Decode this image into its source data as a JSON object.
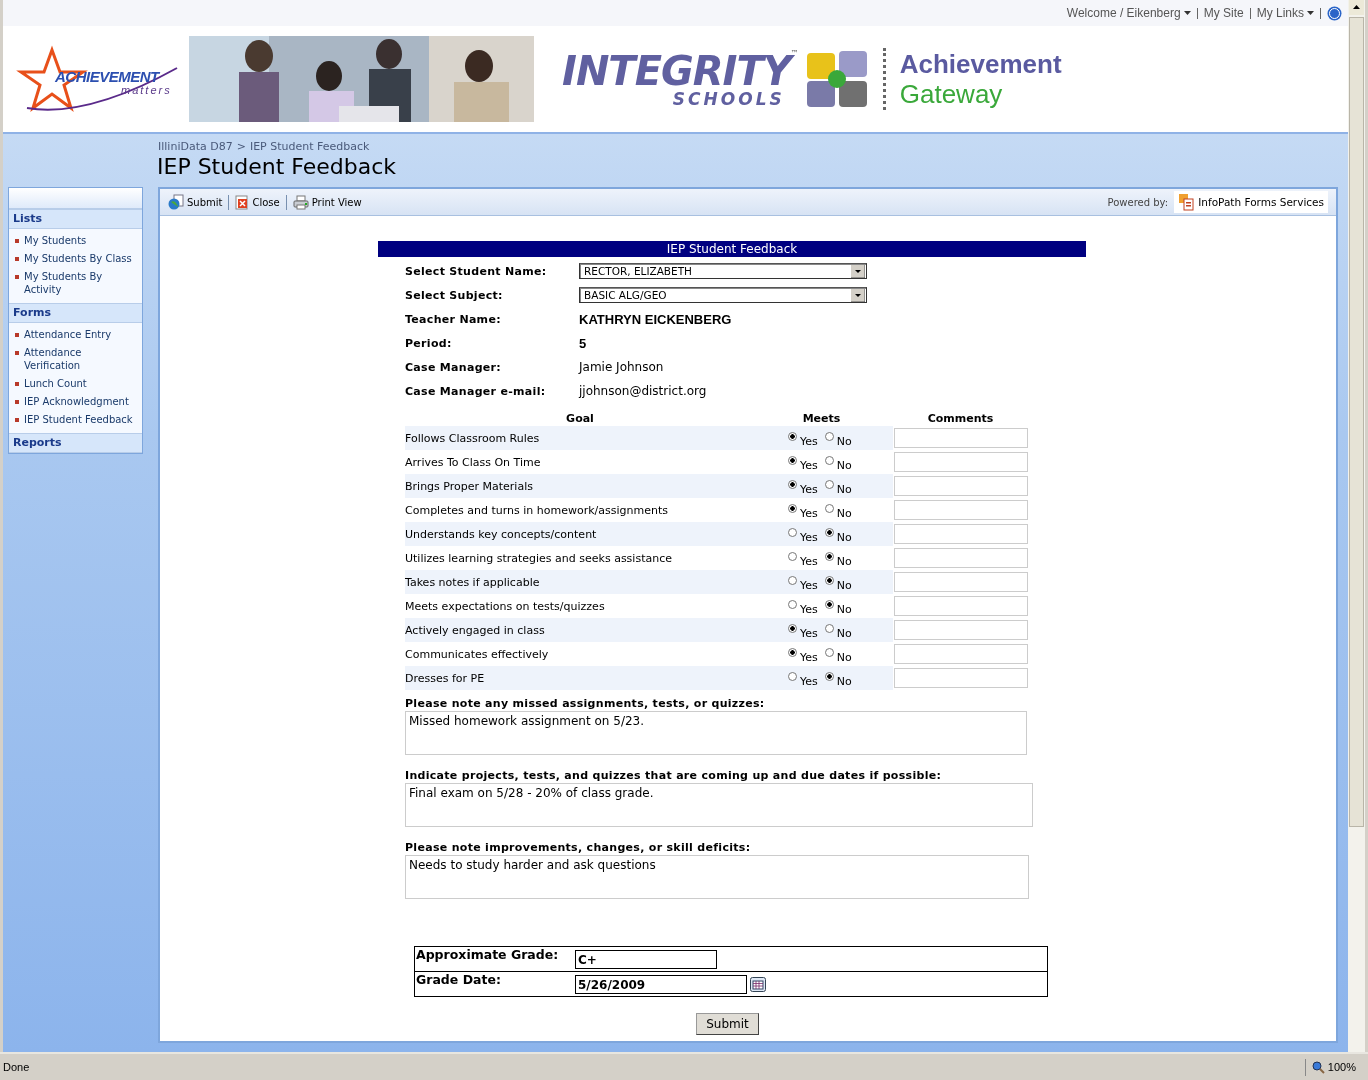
{
  "top_links": [
    {
      "label": "Welcome / Eikenberg",
      "dropdown": true
    },
    {
      "label": "My Site",
      "dropdown": false
    },
    {
      "label": "My Links",
      "dropdown": true
    }
  ],
  "banner": {
    "logo_text": "ACHIEVEMENT",
    "logo_subtext": "matters",
    "brand": "INTEGRITY",
    "brand_mark": "™",
    "brand_sub": "SCHOOLS",
    "gateway_line1": "Achievement",
    "gateway_line2": "Gateway"
  },
  "breadcrumb": {
    "items": [
      "IlliniData D87",
      "IEP Student Feedback"
    ],
    "separator": ">"
  },
  "page_title": "IEP Student Feedback",
  "sidebar": {
    "sections": [
      {
        "heading": "Lists",
        "items": [
          "My Students",
          "My Students By Class",
          "My Students By Activity"
        ]
      },
      {
        "heading": "Forms",
        "items": [
          "Attendance Entry",
          "Attendance Verification",
          "Lunch Count",
          "IEP Acknowledgment",
          "IEP Student Feedback"
        ]
      },
      {
        "heading": "Reports"
      }
    ]
  },
  "toolbar": {
    "buttons": [
      {
        "label": "Submit"
      },
      {
        "label": "Close"
      },
      {
        "label": "Print View"
      }
    ],
    "powered_by": "Powered by:",
    "product": "InfoPath Forms Services"
  },
  "form": {
    "title": "IEP Student Feedback",
    "fields": [
      {
        "label": "Select Student Name:",
        "value": "RECTOR, ELIZABETH",
        "kind": "select"
      },
      {
        "label": "Select Subject:",
        "value": "BASIC ALG/GEO",
        "kind": "select"
      },
      {
        "label": "Teacher Name:",
        "value": "KATHRYN EICKENBERG",
        "kind": "bold"
      },
      {
        "label": "Period:",
        "value": "5",
        "kind": "bold"
      },
      {
        "label": "Case Manager:",
        "value": "Jamie Johnson",
        "kind": "text"
      },
      {
        "label": "Case Manager e-mail:",
        "value": "jjohnson@district.org",
        "kind": "text"
      }
    ],
    "columns": [
      "Goal",
      "Meets",
      "Comments"
    ],
    "goals": [
      {
        "goal": "Follows Classroom Rules",
        "options": [
          {
            "label": "Yes",
            "selected": true
          },
          {
            "label": "No",
            "selected": false
          }
        ]
      },
      {
        "goal": "Arrives To Class On Time",
        "options": [
          {
            "label": "Yes",
            "selected": true
          },
          {
            "label": "No",
            "selected": false
          }
        ]
      },
      {
        "goal": "Brings Proper Materials",
        "options": [
          {
            "label": "Yes",
            "selected": true
          },
          {
            "label": "No",
            "selected": false
          }
        ]
      },
      {
        "goal": "Completes and turns in homework/assignments",
        "options": [
          {
            "label": "Yes",
            "selected": true
          },
          {
            "label": "No",
            "selected": false
          }
        ]
      },
      {
        "goal": "Understands key concepts/content",
        "options": [
          {
            "label": "Yes",
            "selected": false
          },
          {
            "label": "No",
            "selected": true
          }
        ]
      },
      {
        "goal": "Utilizes learning strategies and seeks assistance",
        "options": [
          {
            "label": "Yes",
            "selected": false
          },
          {
            "label": "No",
            "selected": true
          }
        ]
      },
      {
        "goal": "Takes notes if applicable",
        "options": [
          {
            "label": "Yes",
            "selected": false
          },
          {
            "label": "No",
            "selected": true
          }
        ]
      },
      {
        "goal": "Meets expectations on tests/quizzes",
        "options": [
          {
            "label": "Yes",
            "selected": false
          },
          {
            "label": "No",
            "selected": true
          }
        ]
      },
      {
        "goal": "Actively engaged in class",
        "options": [
          {
            "label": "Yes",
            "selected": true
          },
          {
            "label": "No",
            "selected": false
          }
        ]
      },
      {
        "goal": "Communicates effectively",
        "options": [
          {
            "label": "Yes",
            "selected": true
          },
          {
            "label": "No",
            "selected": false
          }
        ]
      },
      {
        "goal": "Dresses for PE",
        "options": [
          {
            "label": "Yes",
            "selected": false
          },
          {
            "label": "No",
            "selected": true
          }
        ]
      }
    ],
    "notes": [
      {
        "label": "Please note any missed assignments, tests, or quizzes:",
        "value": "Missed homework assignment on 5/23."
      },
      {
        "label": "Indicate projects, tests, and quizzes that are coming up and due dates if possible:",
        "value": "Final exam on 5/28 - 20% of class grade."
      },
      {
        "label": "Please note improvements, changes, or skill deficits:",
        "value": "Needs to study harder and ask questions"
      }
    ],
    "grade": [
      {
        "label": "Approximate Grade:",
        "value": "C+",
        "calendar": false
      },
      {
        "label": "Grade Date:",
        "value": "5/26/2009",
        "calendar": true
      }
    ],
    "submit": "Submit"
  },
  "status_bar": {
    "text": "Done",
    "zoom": "100%"
  }
}
